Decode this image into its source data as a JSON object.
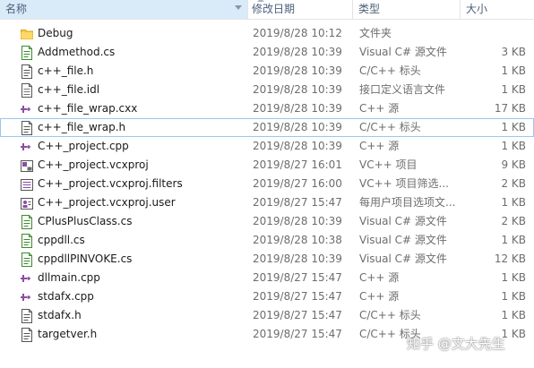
{
  "columns": {
    "name": "名称",
    "date": "修改日期",
    "type": "类型",
    "size": "大小"
  },
  "files": [
    {
      "name": "Debug",
      "date": "2019/8/28 10:12",
      "type": "文件夹",
      "size": "",
      "icon": "folder-icon"
    },
    {
      "name": "Addmethod.cs",
      "date": "2019/8/28 10:39",
      "type": "Visual C# 源文件",
      "size": "3 KB",
      "icon": "cs-file-icon"
    },
    {
      "name": "c++_file.h",
      "date": "2019/8/28 10:39",
      "type": "C/C++ 标头",
      "size": "1 KB",
      "icon": "header-file-icon"
    },
    {
      "name": "c++_file.idl",
      "date": "2019/8/28 10:39",
      "type": "接口定义语言文件",
      "size": "1 KB",
      "icon": "idl-file-icon"
    },
    {
      "name": "c++_file_wrap.cxx",
      "date": "2019/8/28 10:39",
      "type": "C++ 源",
      "size": "17 KB",
      "icon": "cpp-file-icon"
    },
    {
      "name": "c++_file_wrap.h",
      "date": "2019/8/28 10:39",
      "type": "C/C++ 标头",
      "size": "1 KB",
      "icon": "header-file-icon"
    },
    {
      "name": "C++_project.cpp",
      "date": "2019/8/28 10:39",
      "type": "C++ 源",
      "size": "1 KB",
      "icon": "cpp-file-icon"
    },
    {
      "name": "C++_project.vcxproj",
      "date": "2019/8/27 16:01",
      "type": "VC++ 项目",
      "size": "9 KB",
      "icon": "vcxproj-file-icon"
    },
    {
      "name": "C++_project.vcxproj.filters",
      "date": "2019/8/27 16:00",
      "type": "VC++ 项目筛选...",
      "size": "2 KB",
      "icon": "filters-file-icon"
    },
    {
      "name": "C++_project.vcxproj.user",
      "date": "2019/8/27 15:47",
      "type": "每用户项目选项文...",
      "size": "1 KB",
      "icon": "user-file-icon"
    },
    {
      "name": "CPlusPlusClass.cs",
      "date": "2019/8/28 10:39",
      "type": "Visual C# 源文件",
      "size": "2 KB",
      "icon": "cs-file-icon"
    },
    {
      "name": "cppdll.cs",
      "date": "2019/8/28 10:38",
      "type": "Visual C# 源文件",
      "size": "1 KB",
      "icon": "cs-file-icon"
    },
    {
      "name": "cppdllPINVOKE.cs",
      "date": "2019/8/28 10:39",
      "type": "Visual C# 源文件",
      "size": "12 KB",
      "icon": "cs-file-icon"
    },
    {
      "name": "dllmain.cpp",
      "date": "2019/8/27 15:47",
      "type": "C++ 源",
      "size": "1 KB",
      "icon": "cpp-file-icon"
    },
    {
      "name": "stdafx.cpp",
      "date": "2019/8/27 15:47",
      "type": "C++ 源",
      "size": "1 KB",
      "icon": "cpp-file-icon"
    },
    {
      "name": "stdafx.h",
      "date": "2019/8/27 15:47",
      "type": "C/C++ 标头",
      "size": "1 KB",
      "icon": "header-file-icon"
    },
    {
      "name": "targetver.h",
      "date": "2019/8/27 15:47",
      "type": "C/C++ 标头",
      "size": "1 KB",
      "icon": "header-file-icon"
    }
  ],
  "focused_index": 5,
  "watermark": "知乎 @文大先生",
  "colors": {
    "header_selected_bg": "#d9ebf9",
    "focus_border": "#99c7f0",
    "folder": "#f5c84c",
    "cs_green": "#3c8a2e",
    "cpp_purple": "#8a4fa3"
  }
}
